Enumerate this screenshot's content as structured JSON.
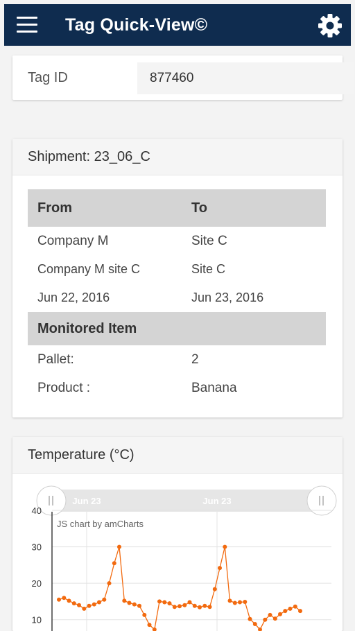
{
  "app": {
    "title": "Tag Quick-View©"
  },
  "tag": {
    "label": "Tag ID",
    "value": "877460"
  },
  "shipment": {
    "header": "Shipment: 23_06_C",
    "from_header": "From",
    "to_header": "To",
    "rows": [
      {
        "from": "Company M",
        "to": "Site C"
      },
      {
        "from": "Company M site C",
        "to": "Site C"
      },
      {
        "from": "Jun 22, 2016",
        "to": "Jun 23, 2016"
      }
    ],
    "monitored_header": "Monitored Item",
    "items": [
      {
        "label": "Pallet:",
        "value": "2"
      },
      {
        "label": "Product :",
        "value": "Banana"
      }
    ]
  },
  "temperature": {
    "header": "Temperature (°C)",
    "credit": "JS chart by amCharts"
  },
  "colors": {
    "topbar": "#0f2c4f",
    "series": "#f26a0f"
  },
  "chart_data": {
    "type": "line",
    "ylabel": "",
    "ylim": [
      5,
      40
    ],
    "yticks": [
      10,
      20,
      30,
      40
    ],
    "scroll_labels": [
      "Jun 23",
      "Jun 23"
    ],
    "series": [
      {
        "values": [
          15.5,
          16,
          15.2,
          14.5,
          14,
          13,
          13.8,
          14.2,
          14.8,
          15.5,
          20,
          25.5,
          30,
          15.2,
          14.6,
          14.2,
          13.8,
          11.3,
          8.6,
          7.3,
          15,
          14.8,
          14.5,
          13.5,
          13.7,
          14,
          14.8,
          13.8,
          13.4,
          13.8,
          13.5,
          18.4,
          24.2,
          30,
          15.2,
          14.6,
          14.8,
          14.9,
          10.2,
          8.8,
          7.3,
          10,
          11.3,
          10.3,
          11.5,
          12.4,
          13,
          13.6,
          12.4
        ]
      }
    ]
  }
}
